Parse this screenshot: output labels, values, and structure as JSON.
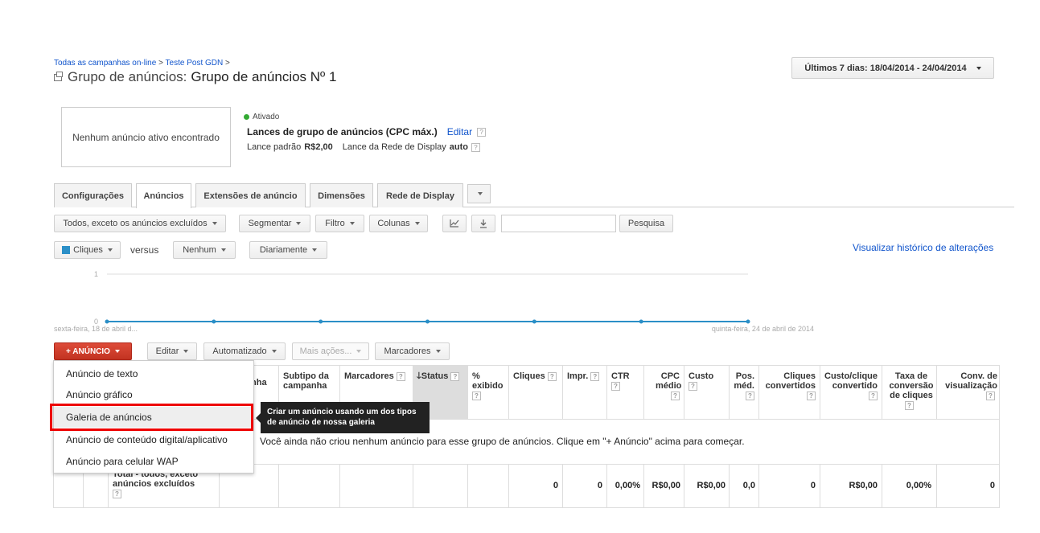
{
  "breadcrumb": {
    "all_campaigns": "Todas as campanhas on-line",
    "sep1": ">",
    "campaign": "Teste Post GDN",
    "sep2": ">"
  },
  "page_title": {
    "prefix": "Grupo de anúncios:",
    "name": "Grupo de anúncios Nº 1"
  },
  "date_range": "Últimos 7 dias: 18/04/2014 - 24/04/2014",
  "ad_preview": "Nenhum anúncio ativo encontrado",
  "status": {
    "label": "Ativado",
    "color": "#3a3"
  },
  "bids": {
    "title": "Lances de grupo de anúncios (CPC máx.)",
    "edit": "Editar",
    "default_label": "Lance padrão",
    "default_value": "R$2,00",
    "display_label": "Lance da Rede de Display",
    "display_value": "auto"
  },
  "tabs": [
    "Configurações",
    "Anúncios",
    "Extensões de anúncio",
    "Dimensões",
    "Rede de Display"
  ],
  "toolbar": {
    "filter_ads": "Todos, exceto os anúncios excluídos",
    "segment": "Segmentar",
    "filter": "Filtro",
    "columns": "Colunas",
    "search_value": "",
    "search": "Pesquisa"
  },
  "chart_controls": {
    "metric1": "Cliques",
    "versus": "versus",
    "metric2": "Nenhum",
    "period": "Diariamente",
    "history": "Visualizar histórico de alterações"
  },
  "chart_data": {
    "type": "line",
    "y_ticks": [
      "1",
      "0"
    ],
    "x_start_label": "sexta-feira, 18 de abril d...",
    "x_end_label": "quinta-feira, 24 de abril de 2014",
    "series": [
      {
        "values": [
          0,
          0,
          0,
          0,
          0,
          0,
          0
        ]
      }
    ],
    "ylim": [
      0,
      1
    ],
    "color": "#2b8fc7"
  },
  "ads_toolbar": {
    "new_ad": "+ ANÚNCIO",
    "edit": "Editar",
    "automate": "Automatizado",
    "more": "Mais ações...",
    "labels": "Marcadores"
  },
  "ad_menu": {
    "items": [
      "Anúncio de texto",
      "Anúncio gráfico",
      "Galeria de anúncios",
      "Anúncio de conteúdo digital/aplicativo",
      "Anúncio para celular WAP"
    ],
    "tooltip": "Criar um anúncio usando um dos tipos de anúncio de nossa galeria"
  },
  "table": {
    "headers": {
      "campaign_tail": "nha",
      "subtype": "Subtipo da campanha",
      "labels": "Marcadores",
      "status": "Status",
      "pct_shown": "% exibido",
      "clicks": "Cliques",
      "impr": "Impr.",
      "ctr": "CTR",
      "avg_cpc": "CPC médio",
      "cost": "Custo",
      "avg_pos": "Pos. méd.",
      "converted_clicks": "Cliques convertidos",
      "cost_per_click": "Custo/clique convertido",
      "click_conv_rate": "Taxa de conversão de cliques",
      "view_through_conv": "Conv. de visualização"
    },
    "empty_message": "Você ainda não criou nenhum anúncio para esse grupo de anúncios. Clique em \"+ Anúncio\" acima para começar.",
    "total": {
      "label": "Total - todos, exceto anúncios excluídos",
      "clicks": "0",
      "impr": "0",
      "ctr": "0,00%",
      "avg_cpc": "R$0,00",
      "cost": "R$0,00",
      "avg_pos": "0,0",
      "converted_clicks": "0",
      "cost_per_click": "R$0,00",
      "click_conv_rate": "0,00%",
      "view_through_conv": "0"
    }
  }
}
